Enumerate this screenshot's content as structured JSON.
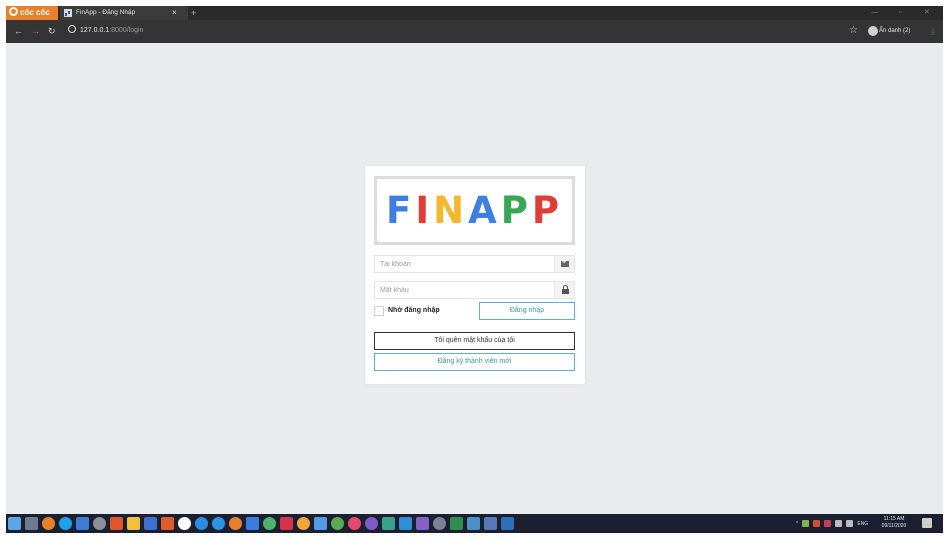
{
  "browser": {
    "brand": "cốc cốc",
    "tab_title": "FinApp - Đăng Nhập",
    "tab_close": "×",
    "new_tab": "+",
    "url_host": "127.0.0.1",
    "url_path": ":8000/login",
    "profile_label": "Ẩn danh (2)"
  },
  "login": {
    "logo_letters": [
      "F",
      "I",
      "N",
      "A",
      "P",
      "P"
    ],
    "username_placeholder": "Tài khoản",
    "password_placeholder": "Mật khẩu",
    "remember_label": "Nhớ đăng nhập",
    "login_button": "Đăng nhập",
    "forgot_button": "Tôi quên mật khẩu của tôi",
    "register_button": "Đăng ký thành viên mới"
  },
  "colors": {
    "logo_blue": "#3f7fe0",
    "logo_red": "#df3d35",
    "logo_yellow": "#f5b72e",
    "logo_green": "#36a853",
    "accent_teal": "#3a9ab3",
    "page_bg": "#e9ebee"
  },
  "taskbar": {
    "language": "ENG",
    "time": "11:15 AM",
    "date": "09/11/2020"
  }
}
